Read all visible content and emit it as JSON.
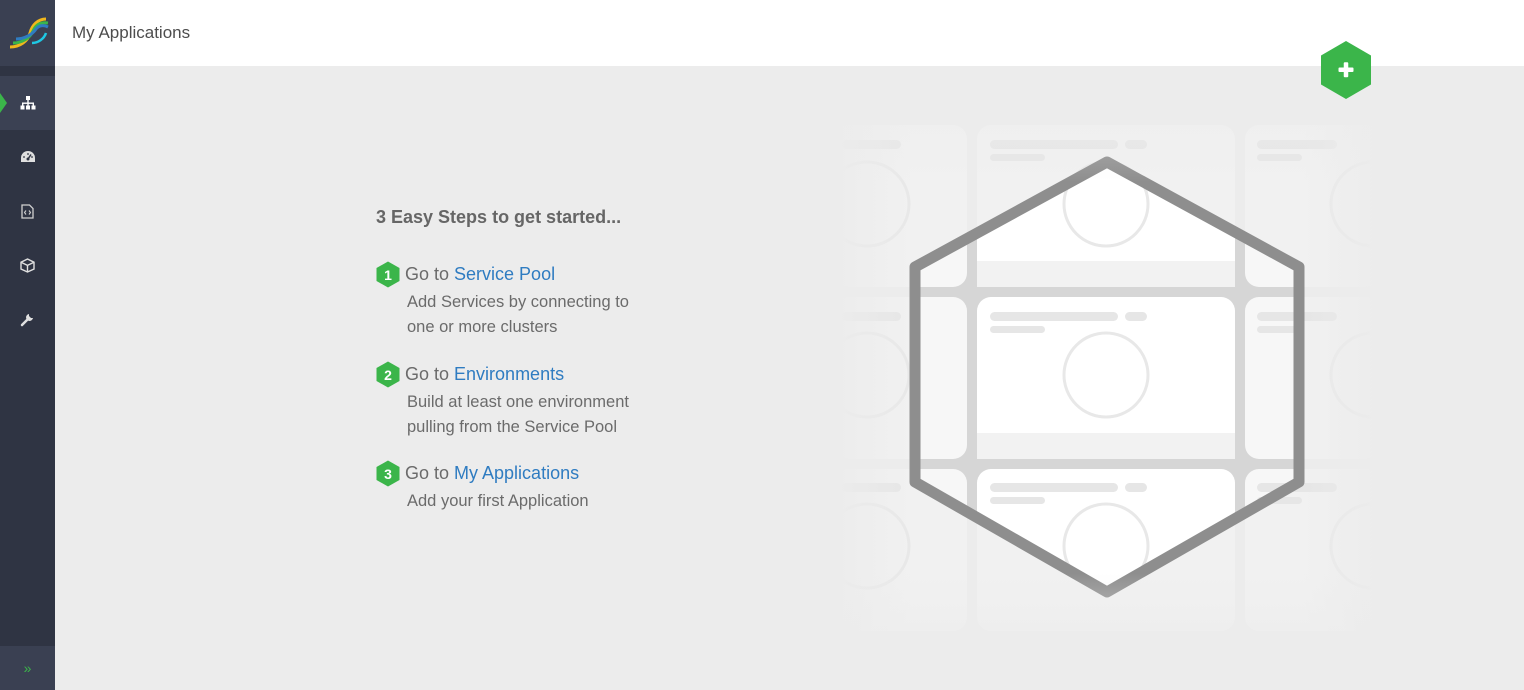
{
  "header": {
    "title": "My Applications"
  },
  "sidebar": {
    "logo": "logo-icon",
    "items": [
      {
        "name": "sitemap-icon",
        "active": true
      },
      {
        "name": "dashboard-icon",
        "active": false
      },
      {
        "name": "code-file-icon",
        "active": false
      },
      {
        "name": "package-icon",
        "active": false
      },
      {
        "name": "wrench-icon",
        "active": false
      }
    ],
    "collapse_label": "»"
  },
  "add_button": {
    "icon": "plus-icon",
    "color": "#3bb54a"
  },
  "steps": {
    "heading": "3 Easy Steps to get started...",
    "items": [
      {
        "num": "1",
        "prefix": "Go to",
        "link": "Service Pool",
        "desc1": "Add Services by connecting to",
        "desc2": "one or more clusters"
      },
      {
        "num": "2",
        "prefix": "Go to",
        "link": "Environments",
        "desc1": "Build at least one environment",
        "desc2": "pulling from the Service Pool"
      },
      {
        "num": "3",
        "prefix": "Go to",
        "link": "My Applications",
        "desc1": "Add your first Application",
        "desc2": ""
      }
    ]
  },
  "colors": {
    "accent": "#3bb54a",
    "link": "#2f7cc1",
    "sidebar": "#2f3443"
  }
}
